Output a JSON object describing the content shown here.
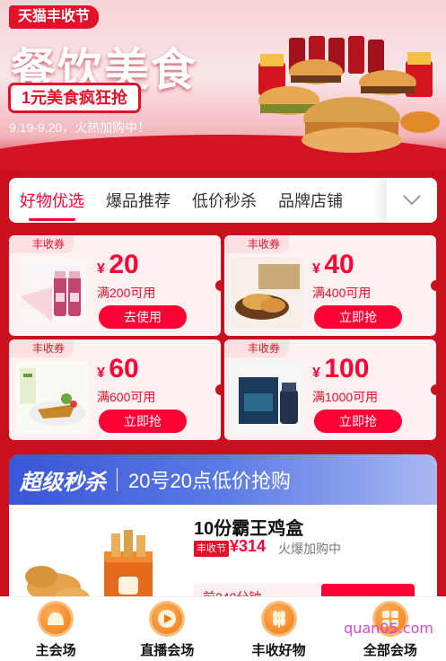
{
  "banner": {
    "brand_tag": "天猫丰收节",
    "title": "餐饮美食",
    "subtitle": "1元美食疯狂抢",
    "date_text": "9.19-9.20，火热加购中！"
  },
  "tabs": [
    {
      "label": "好物优选",
      "active": true
    },
    {
      "label": "爆品推荐",
      "active": false
    },
    {
      "label": "低价秒杀",
      "active": false
    },
    {
      "label": "品牌店铺",
      "active": false
    }
  ],
  "coupons": [
    {
      "tag": "丰收券",
      "currency": "¥",
      "amount": "20",
      "condition": "满200可用",
      "button": "去使用"
    },
    {
      "tag": "丰收券",
      "currency": "¥",
      "amount": "40",
      "condition": "满400可用",
      "button": "立即抢"
    },
    {
      "tag": "丰收券",
      "currency": "¥",
      "amount": "60",
      "condition": "满600可用",
      "button": "立即抢"
    },
    {
      "tag": "丰收券",
      "currency": "¥",
      "amount": "100",
      "condition": "满1000可用",
      "button": "立即抢"
    }
  ],
  "flash_sale": {
    "title": "超级秒杀",
    "subtitle": "20号20点低价抢购",
    "product": {
      "name": "10份霸王鸡盒",
      "badge": "丰收节",
      "price": "¥314",
      "status": "火爆加购中",
      "progress_text": "前240分钟"
    }
  },
  "bottom_nav": [
    {
      "label": "主会场",
      "icon": "main-venue-icon"
    },
    {
      "label": "直播会场",
      "icon": "play-icon"
    },
    {
      "label": "丰收好物",
      "icon": "wheat-icon"
    },
    {
      "label": "全部会场",
      "icon": "grid-icon"
    }
  ],
  "watermark": "quan05.com",
  "colors": {
    "accent": "#ff0036",
    "brand_red": "#c8101e",
    "sale_blue": "#3a55d6"
  }
}
